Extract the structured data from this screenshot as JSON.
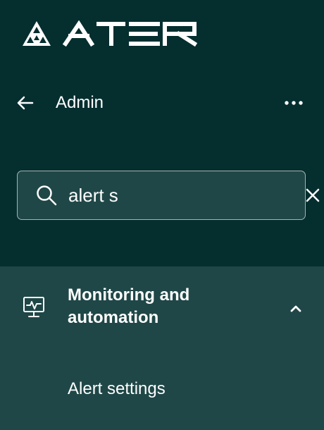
{
  "brand": {
    "logo_name": "atera-logo",
    "wordmark_icon": "atera-wordmark"
  },
  "header": {
    "back_icon": "arrow-left-icon",
    "title": "Admin",
    "more_icon": "more-horizontal-icon"
  },
  "search": {
    "value": "alert s",
    "placeholder": "",
    "search_icon": "search-icon",
    "clear_icon": "close-icon"
  },
  "menu": {
    "group": {
      "icon": "monitor-icon",
      "label": "Monitoring and\nautomation",
      "expanded_icon": "chevron-up-icon"
    },
    "items": [
      {
        "label": "Alert settings"
      }
    ]
  },
  "colors": {
    "background": "#052e2f",
    "surface": "#204747",
    "border": "#a6b4b3",
    "text": "#ffffff"
  }
}
